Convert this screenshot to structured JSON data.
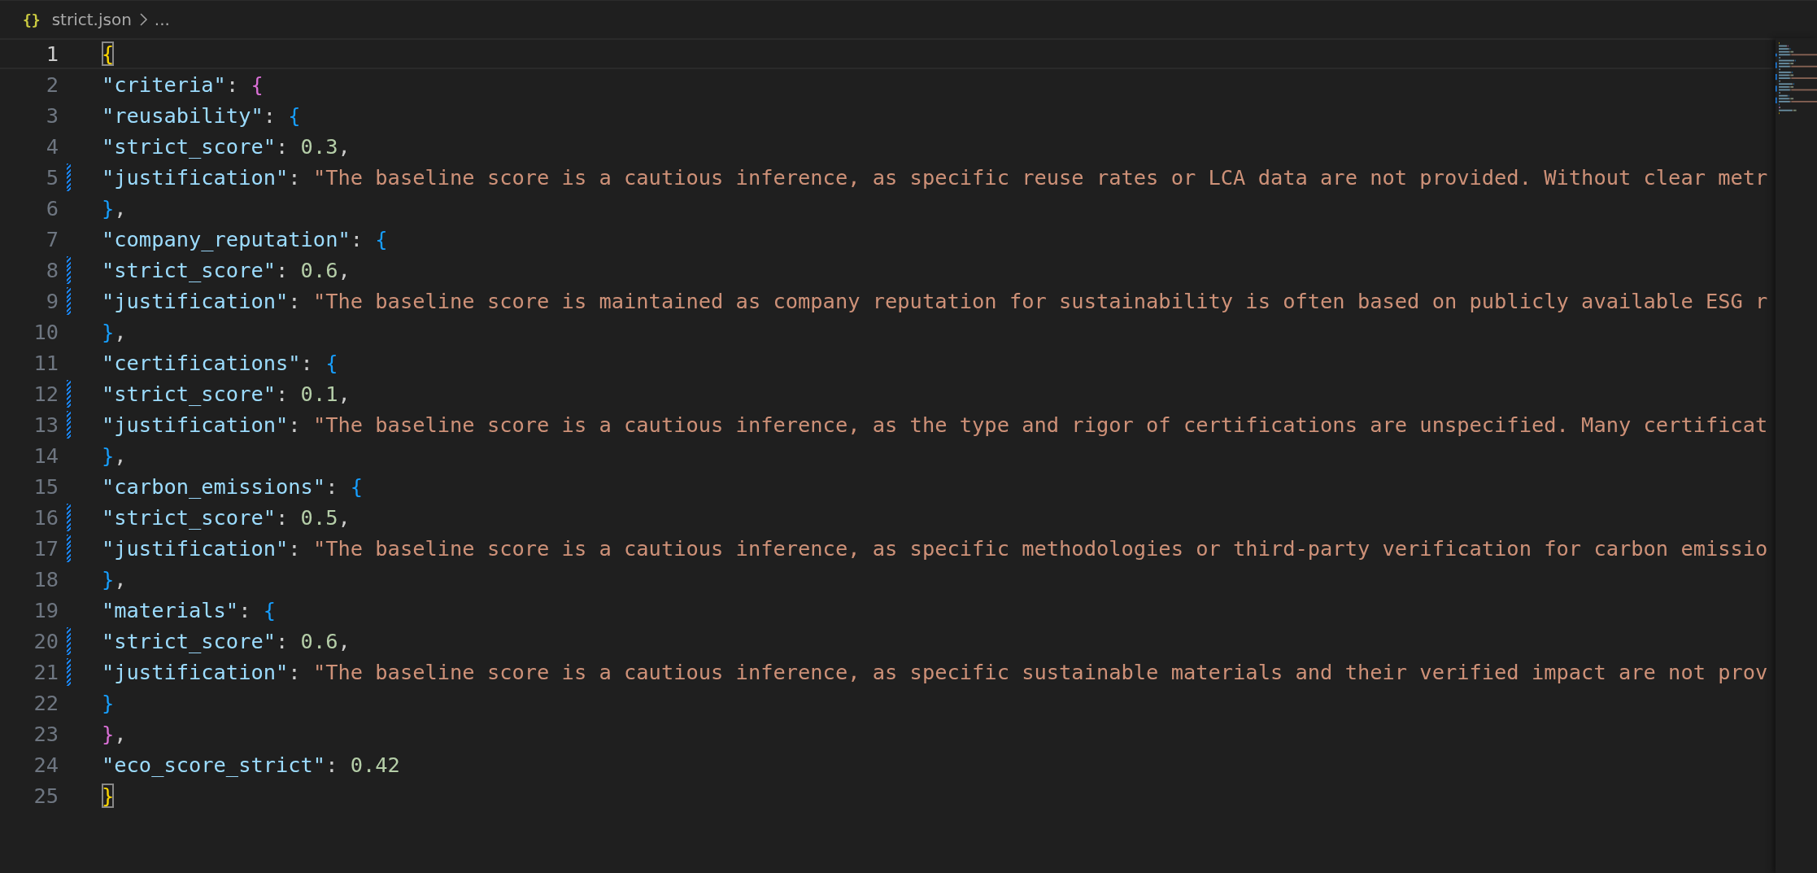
{
  "breadcrumb": {
    "file_icon": "{}",
    "file": "strict.json",
    "more": "..."
  },
  "lines": [
    {
      "number": "1",
      "selected": true,
      "modified": false,
      "tokens": [
        {
          "kind": "brace",
          "text": "{",
          "color": "#ffd700",
          "matched": true
        }
      ]
    },
    {
      "number": "2",
      "selected": false,
      "modified": false,
      "tokens": [
        {
          "kind": "key",
          "text": "\"criteria\""
        },
        {
          "kind": "punct",
          "text": ": "
        },
        {
          "kind": "brace",
          "text": "{",
          "color": "#da70d6",
          "matched": false
        }
      ]
    },
    {
      "number": "3",
      "selected": false,
      "modified": false,
      "tokens": [
        {
          "kind": "key",
          "text": "\"reusability\""
        },
        {
          "kind": "punct",
          "text": ": "
        },
        {
          "kind": "brace",
          "text": "{",
          "color": "#179fff",
          "matched": false
        }
      ]
    },
    {
      "number": "4",
      "selected": false,
      "modified": false,
      "tokens": [
        {
          "kind": "key",
          "text": "\"strict_score\""
        },
        {
          "kind": "punct",
          "text": ": "
        },
        {
          "kind": "number",
          "text": "0.3"
        },
        {
          "kind": "punct",
          "text": ","
        }
      ]
    },
    {
      "number": "5",
      "selected": false,
      "modified": true,
      "tokens": [
        {
          "kind": "key",
          "text": "\"justification\""
        },
        {
          "kind": "punct",
          "text": ": "
        },
        {
          "kind": "string",
          "text": "\"The baseline score is a cautious inference, as specific reuse rates or LCA data are not provided. Without clear metr"
        }
      ]
    },
    {
      "number": "6",
      "selected": false,
      "modified": false,
      "tokens": [
        {
          "kind": "brace",
          "text": "}",
          "color": "#179fff",
          "matched": false
        },
        {
          "kind": "punct",
          "text": ","
        }
      ]
    },
    {
      "number": "7",
      "selected": false,
      "modified": false,
      "tokens": [
        {
          "kind": "key",
          "text": "\"company_reputation\""
        },
        {
          "kind": "punct",
          "text": ": "
        },
        {
          "kind": "brace",
          "text": "{",
          "color": "#179fff",
          "matched": false
        }
      ]
    },
    {
      "number": "8",
      "selected": false,
      "modified": true,
      "tokens": [
        {
          "kind": "key",
          "text": "\"strict_score\""
        },
        {
          "kind": "punct",
          "text": ": "
        },
        {
          "kind": "number",
          "text": "0.6"
        },
        {
          "kind": "punct",
          "text": ","
        }
      ]
    },
    {
      "number": "9",
      "selected": false,
      "modified": true,
      "tokens": [
        {
          "kind": "key",
          "text": "\"justification\""
        },
        {
          "kind": "punct",
          "text": ": "
        },
        {
          "kind": "string",
          "text": "\"The baseline score is maintained as company reputation for sustainability is often based on publicly available ESG r"
        }
      ]
    },
    {
      "number": "10",
      "selected": false,
      "modified": false,
      "tokens": [
        {
          "kind": "brace",
          "text": "}",
          "color": "#179fff",
          "matched": false
        },
        {
          "kind": "punct",
          "text": ","
        }
      ]
    },
    {
      "number": "11",
      "selected": false,
      "modified": false,
      "tokens": [
        {
          "kind": "key",
          "text": "\"certifications\""
        },
        {
          "kind": "punct",
          "text": ": "
        },
        {
          "kind": "brace",
          "text": "{",
          "color": "#179fff",
          "matched": false
        }
      ]
    },
    {
      "number": "12",
      "selected": false,
      "modified": true,
      "tokens": [
        {
          "kind": "key",
          "text": "\"strict_score\""
        },
        {
          "kind": "punct",
          "text": ": "
        },
        {
          "kind": "number",
          "text": "0.1"
        },
        {
          "kind": "punct",
          "text": ","
        }
      ]
    },
    {
      "number": "13",
      "selected": false,
      "modified": true,
      "tokens": [
        {
          "kind": "key",
          "text": "\"justification\""
        },
        {
          "kind": "punct",
          "text": ": "
        },
        {
          "kind": "string",
          "text": "\"The baseline score is a cautious inference, as the type and rigor of certifications are unspecified. Many certificat"
        }
      ]
    },
    {
      "number": "14",
      "selected": false,
      "modified": false,
      "tokens": [
        {
          "kind": "brace",
          "text": "}",
          "color": "#179fff",
          "matched": false
        },
        {
          "kind": "punct",
          "text": ","
        }
      ]
    },
    {
      "number": "15",
      "selected": false,
      "modified": false,
      "tokens": [
        {
          "kind": "key",
          "text": "\"carbon_emissions\""
        },
        {
          "kind": "punct",
          "text": ": "
        },
        {
          "kind": "brace",
          "text": "{",
          "color": "#179fff",
          "matched": false
        }
      ]
    },
    {
      "number": "16",
      "selected": false,
      "modified": true,
      "tokens": [
        {
          "kind": "key",
          "text": "\"strict_score\""
        },
        {
          "kind": "punct",
          "text": ": "
        },
        {
          "kind": "number",
          "text": "0.5"
        },
        {
          "kind": "punct",
          "text": ","
        }
      ]
    },
    {
      "number": "17",
      "selected": false,
      "modified": true,
      "tokens": [
        {
          "kind": "key",
          "text": "\"justification\""
        },
        {
          "kind": "punct",
          "text": ": "
        },
        {
          "kind": "string",
          "text": "\"The baseline score is a cautious inference, as specific methodologies or third-party verification for carbon emissio"
        }
      ]
    },
    {
      "number": "18",
      "selected": false,
      "modified": false,
      "tokens": [
        {
          "kind": "brace",
          "text": "}",
          "color": "#179fff",
          "matched": false
        },
        {
          "kind": "punct",
          "text": ","
        }
      ]
    },
    {
      "number": "19",
      "selected": false,
      "modified": false,
      "tokens": [
        {
          "kind": "key",
          "text": "\"materials\""
        },
        {
          "kind": "punct",
          "text": ": "
        },
        {
          "kind": "brace",
          "text": "{",
          "color": "#179fff",
          "matched": false
        }
      ]
    },
    {
      "number": "20",
      "selected": false,
      "modified": true,
      "tokens": [
        {
          "kind": "key",
          "text": "\"strict_score\""
        },
        {
          "kind": "punct",
          "text": ": "
        },
        {
          "kind": "number",
          "text": "0.6"
        },
        {
          "kind": "punct",
          "text": ","
        }
      ]
    },
    {
      "number": "21",
      "selected": false,
      "modified": true,
      "tokens": [
        {
          "kind": "key",
          "text": "\"justification\""
        },
        {
          "kind": "punct",
          "text": ": "
        },
        {
          "kind": "string",
          "text": "\"The baseline score is a cautious inference, as specific sustainable materials and their verified impact are not prov"
        }
      ]
    },
    {
      "number": "22",
      "selected": false,
      "modified": false,
      "tokens": [
        {
          "kind": "brace",
          "text": "}",
          "color": "#179fff",
          "matched": false
        }
      ]
    },
    {
      "number": "23",
      "selected": false,
      "modified": false,
      "tokens": [
        {
          "kind": "brace",
          "text": "}",
          "color": "#da70d6",
          "matched": false
        },
        {
          "kind": "punct",
          "text": ","
        }
      ]
    },
    {
      "number": "24",
      "selected": false,
      "modified": false,
      "tokens": [
        {
          "kind": "key",
          "text": "\"eco_score_strict\""
        },
        {
          "kind": "punct",
          "text": ": "
        },
        {
          "kind": "number",
          "text": "0.42"
        }
      ]
    },
    {
      "number": "25",
      "selected": false,
      "modified": false,
      "tokens": [
        {
          "kind": "brace",
          "text": "}",
          "color": "#ffd700",
          "matched": true
        }
      ]
    }
  ]
}
